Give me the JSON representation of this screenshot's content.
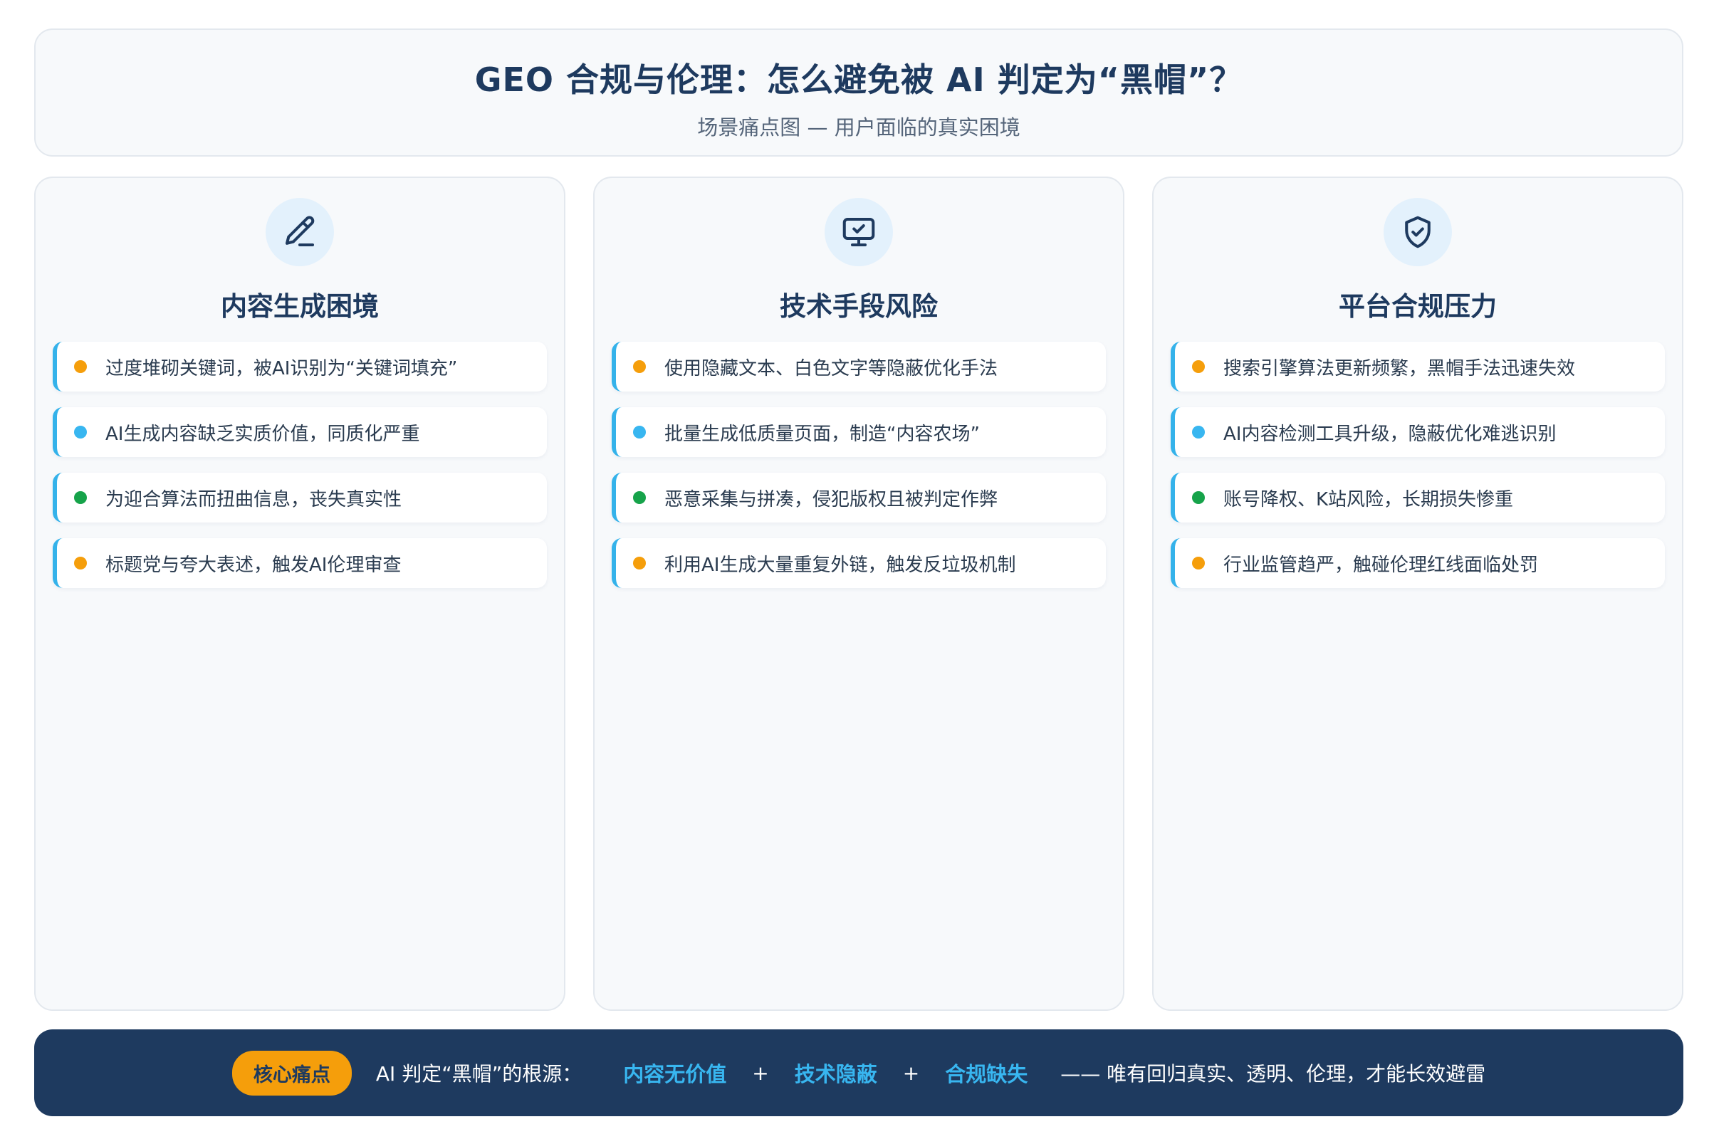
{
  "header": {
    "title": "GEO 合规与伦理：怎么避免被 AI 判定为“黑帽”？",
    "subtitle": "场景痛点图 — 用户面临的真实困境"
  },
  "columns": [
    {
      "icon": "pencil-icon",
      "title": "内容生成困境",
      "items": [
        {
          "text": "过度堆砌关键词，被AI识别为“关键词填充”",
          "dot_color": "#f59e0b"
        },
        {
          "text": "AI生成内容缺乏实质价值，同质化严重",
          "dot_color": "#38b6f0"
        },
        {
          "text": "为迎合算法而扭曲信息，丧失真实性",
          "dot_color": "#16a34a"
        },
        {
          "text": "标题党与夸大表述，触发AI伦理审查",
          "dot_color": "#f59e0b"
        }
      ]
    },
    {
      "icon": "monitor-check-icon",
      "title": "技术手段风险",
      "items": [
        {
          "text": "使用隐藏文本、白色文字等隐蔽优化手法",
          "dot_color": "#f59e0b"
        },
        {
          "text": "批量生成低质量页面，制造“内容农场”",
          "dot_color": "#38b6f0"
        },
        {
          "text": "恶意采集与拼凑，侵犯版权且被判定作弊",
          "dot_color": "#16a34a"
        },
        {
          "text": "利用AI生成大量重复外链，触发反垃圾机制",
          "dot_color": "#f59e0b"
        }
      ]
    },
    {
      "icon": "shield-check-icon",
      "title": "平台合规压力",
      "items": [
        {
          "text": "搜索引擎算法更新频繁，黑帽手法迅速失效",
          "dot_color": "#f59e0b"
        },
        {
          "text": "AI内容检测工具升级，隐蔽优化难逃识别",
          "dot_color": "#38b6f0"
        },
        {
          "text": "账号降权、K站风险，长期损失惨重",
          "dot_color": "#16a34a"
        },
        {
          "text": "行业监管趋严，触碰伦理红线面临处罚",
          "dot_color": "#f59e0b"
        }
      ]
    }
  ],
  "footer": {
    "badge": "核心痛点",
    "lead": "AI 判定“黑帽”的根源：",
    "key1": "内容无价值",
    "plus1": "+",
    "key2": "技术隐蔽",
    "plus2": "+",
    "key3": "合规缺失",
    "tail": "—— 唯有回归真实、透明、伦理，才能长效避雷"
  },
  "colors": {
    "navy": "#1e3a5f",
    "accent_blue": "#38b6f0",
    "orange": "#f59e0b",
    "green": "#16a34a"
  }
}
